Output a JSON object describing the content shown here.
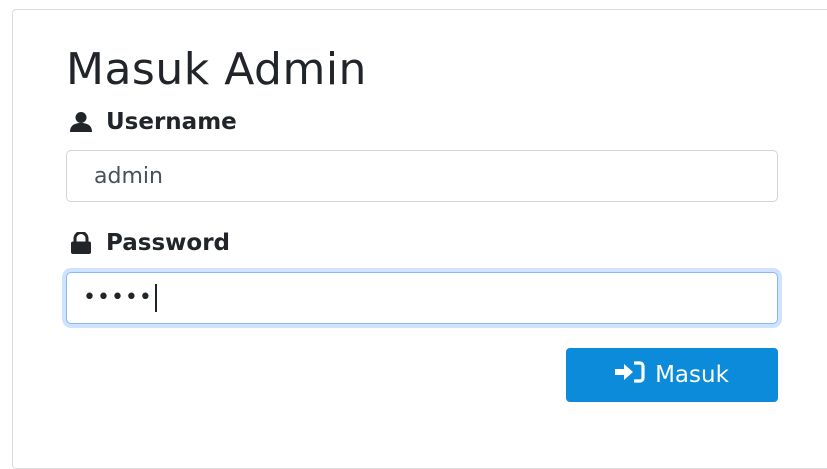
{
  "card": {
    "title": "Masuk Admin"
  },
  "username": {
    "label": "Username",
    "icon": "user-icon",
    "value": "admin"
  },
  "password": {
    "label": "Password",
    "icon": "lock-icon",
    "masked_value": "•••••"
  },
  "submit": {
    "label": "Masuk",
    "icon": "sign-in-icon"
  },
  "colors": {
    "button_bg": "#0b8bd9",
    "focus_border": "#86b7fe",
    "text": "#212529"
  }
}
